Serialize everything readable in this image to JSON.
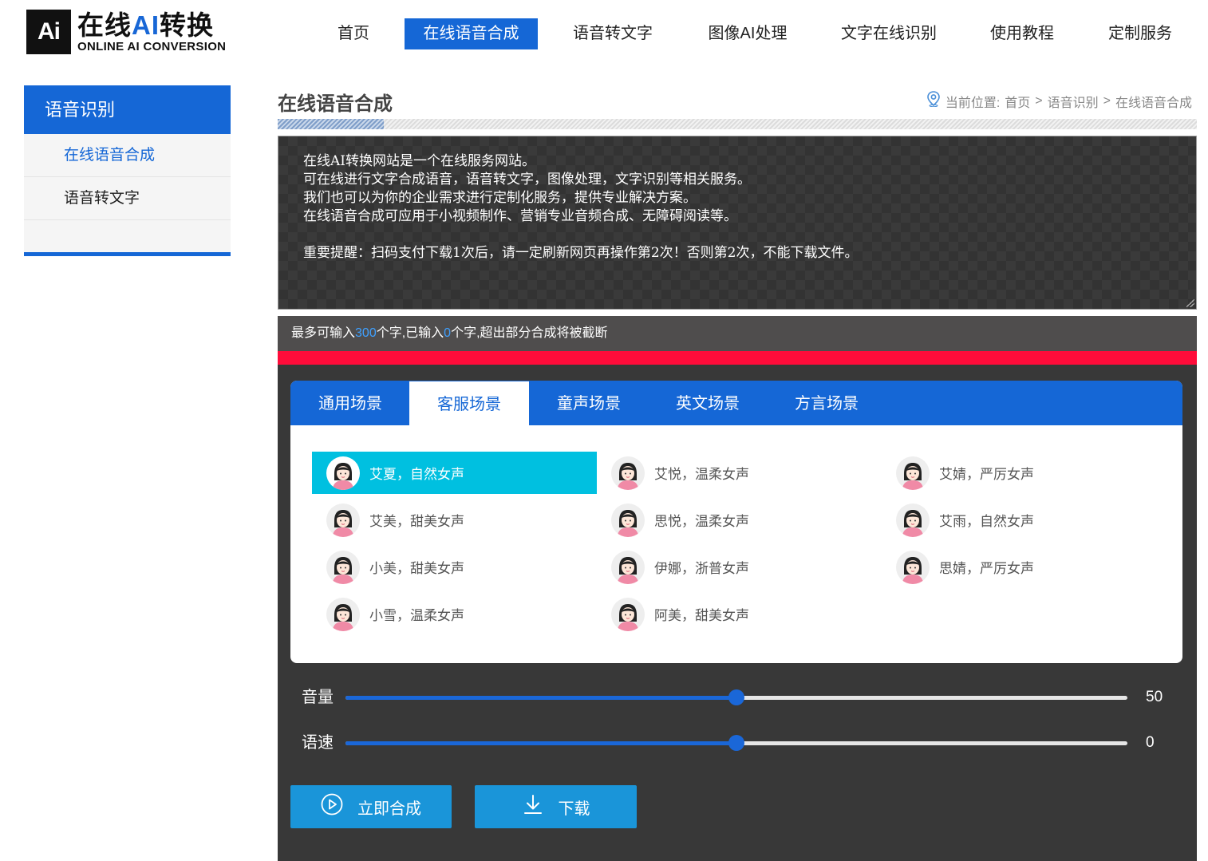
{
  "logo": {
    "badge": "Ai",
    "cn_part1": "在线",
    "cn_ai": "AI",
    "cn_part2": "转换",
    "en": "ONLINE AI CONVERSION"
  },
  "nav": [
    {
      "label": "首页",
      "active": false
    },
    {
      "label": "在线语音合成",
      "active": true
    },
    {
      "label": "语音转文字",
      "active": false
    },
    {
      "label": "图像AI处理",
      "active": false
    },
    {
      "label": "文字在线识别",
      "active": false
    },
    {
      "label": "使用教程",
      "active": false
    },
    {
      "label": "定制服务",
      "active": false
    }
  ],
  "sidebar": {
    "title": "语音识别",
    "items": [
      {
        "label": "在线语音合成",
        "active": true
      },
      {
        "label": "语音转文字",
        "active": false
      }
    ]
  },
  "page": {
    "title": "在线语音合成",
    "breadcrumb": {
      "prefix": "当前位置:",
      "items": [
        "首页",
        "语音识别",
        "在线语音合成"
      ],
      "separator": ">"
    }
  },
  "textarea": {
    "lines": [
      "在线AI转换网站是一个在线服务网站。",
      "可在线进行文字合成语音，语音转文字，图像处理，文字识别等相关服务。",
      "我们也可以为你的企业需求进行定制化服务，提供专业解决方案。",
      "在线语音合成可应用于小视频制作、营销专业音频合成、无障碍阅读等。",
      "",
      "重要提醒：扫码支付下载1次后，请一定刷新网页再操作第2次！否则第2次，不能下载文件。"
    ]
  },
  "counter": {
    "part1": "最多可输入",
    "max": "300",
    "part2": "个字,已输入",
    "current": "0",
    "part3": "个字,超出部分合成将被截断"
  },
  "tabs": [
    {
      "label": "通用场景",
      "active": false
    },
    {
      "label": "客服场景",
      "active": true
    },
    {
      "label": "童声场景",
      "active": false
    },
    {
      "label": "英文场景",
      "active": false
    },
    {
      "label": "方言场景",
      "active": false
    }
  ],
  "voices": [
    {
      "label": "艾夏，自然女声",
      "active": true
    },
    {
      "label": "艾悦，温柔女声",
      "active": false
    },
    {
      "label": "艾婧，严厉女声",
      "active": false
    },
    {
      "label": "艾美，甜美女声",
      "active": false
    },
    {
      "label": "思悦，温柔女声",
      "active": false
    },
    {
      "label": "艾雨，自然女声",
      "active": false
    },
    {
      "label": "小美，甜美女声",
      "active": false
    },
    {
      "label": "伊娜，浙普女声",
      "active": false
    },
    {
      "label": "思婧，严厉女声",
      "active": false
    },
    {
      "label": "小雪，温柔女声",
      "active": false
    },
    {
      "label": "阿美，甜美女声",
      "active": false
    }
  ],
  "sliders": {
    "volume": {
      "label": "音量",
      "value": "50",
      "fraction": 0.5
    },
    "speed": {
      "label": "语速",
      "value": "0",
      "fraction": 0.5
    }
  },
  "buttons": {
    "synthesize": "立即合成",
    "download": "下载"
  },
  "colors": {
    "primary": "#1567d6",
    "selected_voice": "#00c0e0",
    "alert_strip": "#ff0c3a",
    "button": "#1a95d9"
  }
}
